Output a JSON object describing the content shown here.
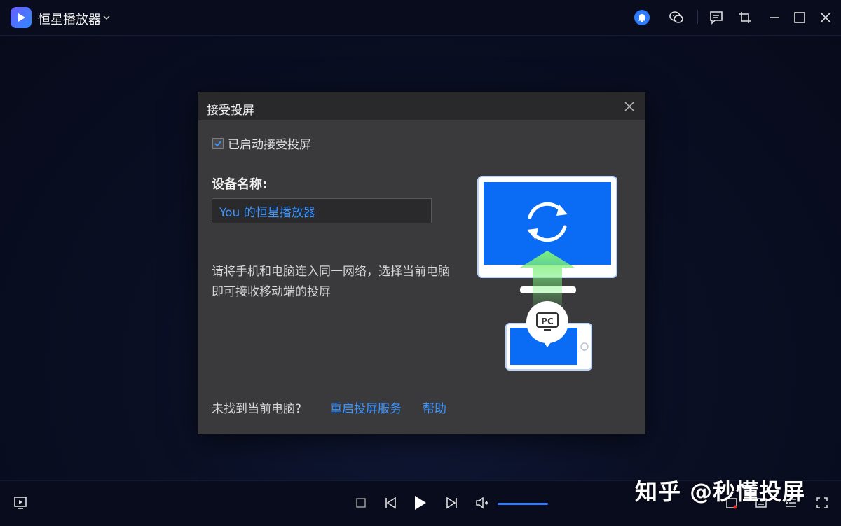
{
  "app": {
    "title": "恒星播放器"
  },
  "dialog": {
    "title": "接受投屏",
    "checkbox_label": "已启动接受投屏",
    "checkbox_checked": true,
    "device_name_label": "设备名称:",
    "device_name_value": "You 的恒星播放器",
    "description": "请将手机和电脑连入同一网络，选择当前电脑即可接收移动端的投屏",
    "footer_question": "未找到当前电脑?",
    "restart_link": "重启投屏服务",
    "help_link": "帮助",
    "illustration_badge": "PC"
  },
  "player": {
    "volume_fraction": 1.0
  },
  "watermark": "知乎 @秒懂投屏",
  "colors": {
    "accent": "#2e7bff",
    "link": "#3d95ff",
    "dialog_bg": "#3a3a3c",
    "dialog_header": "#29292b",
    "app_bg": "#0a0f24"
  }
}
